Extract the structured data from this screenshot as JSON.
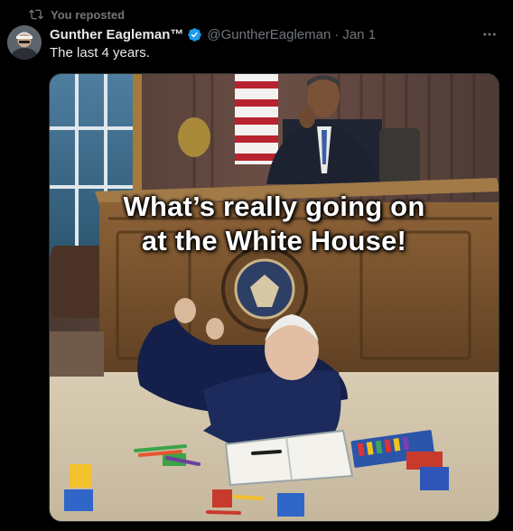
{
  "repost": {
    "label": "You reposted",
    "icon": "repost-icon"
  },
  "author": {
    "name": "Gunther Eagleman™",
    "handle": "@GuntherEagleman",
    "separator": "·",
    "date": "Jan 1",
    "verified": true,
    "verified_color": "#1d9bf0"
  },
  "post": {
    "text": "The last 4 years."
  },
  "media": {
    "caption_line1": "What’s really going on",
    "caption_line2": "at the White House!"
  },
  "colors": {
    "background": "#000000",
    "primary_text": "#e7e9ea",
    "secondary_text": "#71767b",
    "border": "#2f3336"
  }
}
